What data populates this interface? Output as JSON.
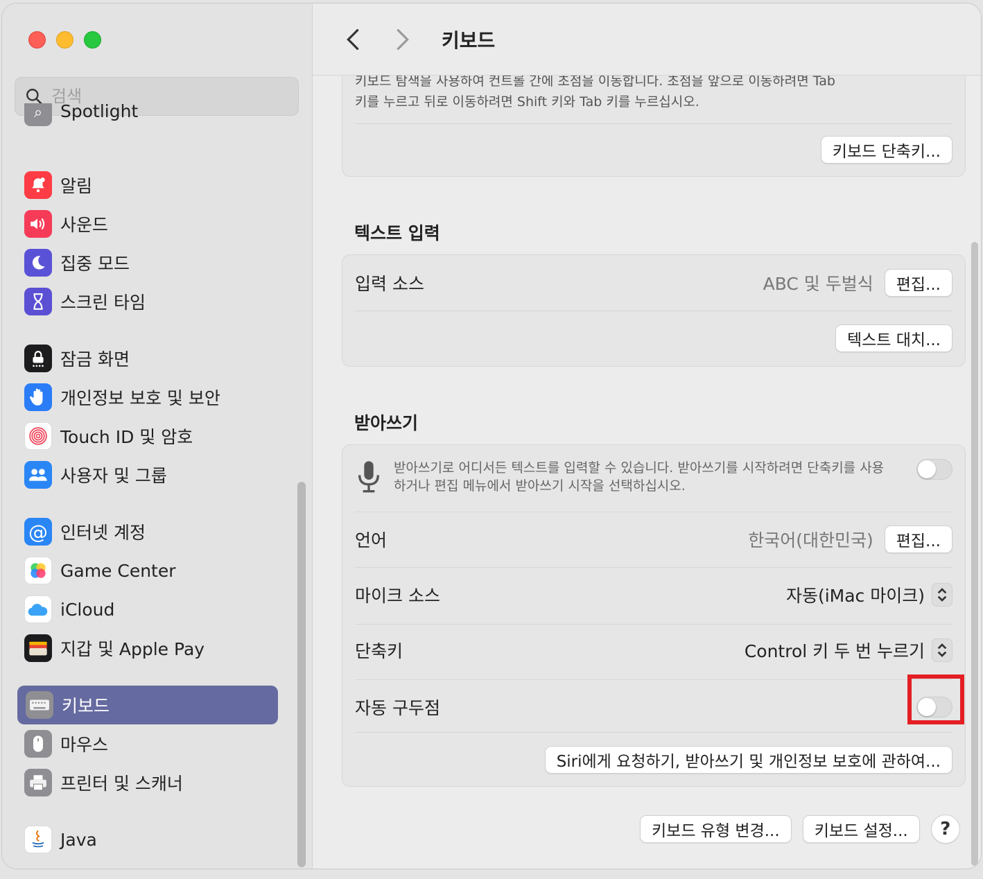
{
  "window": {
    "title": "키보드"
  },
  "sidebar": {
    "search_placeholder": "검색",
    "partial_item": "Spotlight",
    "items": [
      {
        "label": "알림",
        "icon": "bell-icon",
        "color": "#fd3c45"
      },
      {
        "label": "사운드",
        "icon": "speaker-icon",
        "color": "#f53b58"
      },
      {
        "label": "집중 모드",
        "icon": "moon-icon",
        "color": "#5a52d6"
      },
      {
        "label": "스크린 타임",
        "icon": "hourglass-icon",
        "color": "#5b4fd4"
      },
      {
        "label": "잠금 화면",
        "icon": "lock-icon",
        "color": "#1c1c1e"
      },
      {
        "label": "개인정보 보호 및 보안",
        "icon": "hand-icon",
        "color": "#2a7cf7"
      },
      {
        "label": "Touch ID 및 암호",
        "icon": "fingerprint-icon",
        "color": "#ffffff"
      },
      {
        "label": "사용자 및 그룹",
        "icon": "users-icon",
        "color": "#2a86f5"
      },
      {
        "label": "인터넷 계정",
        "icon": "at-icon",
        "color": "#2a86f5"
      },
      {
        "label": "Game Center",
        "icon": "game-center-icon",
        "color": "#ffffff"
      },
      {
        "label": "iCloud",
        "icon": "cloud-icon",
        "color": "#ffffff"
      },
      {
        "label": "지갑 및 Apple Pay",
        "icon": "wallet-icon",
        "color": "#1c1c1e"
      },
      {
        "label": "키보드",
        "icon": "keyboard-icon",
        "color": "#8e8e93",
        "active": true
      },
      {
        "label": "마우스",
        "icon": "mouse-icon",
        "color": "#8e8e93"
      },
      {
        "label": "프린터 및 스캐너",
        "icon": "printer-icon",
        "color": "#8e8e93"
      },
      {
        "label": "Java",
        "icon": "java-icon",
        "color": "#ffffff"
      }
    ]
  },
  "nav_section": {
    "desc_line1": "키보드 탐색을 사용하여 컨트롤 간에 초점을 이동합니다. 초점을 앞으로 이동하려면 Tab",
    "desc_line2": "키를 누르고 뒤로 이동하려면 Shift 키와 Tab 키를 누르십시오.",
    "shortcuts_button": "키보드 단축키..."
  },
  "text_input": {
    "title": "텍스트 입력",
    "input_sources_label": "입력 소스",
    "input_sources_value": "ABC 및 두벌식",
    "input_sources_edit": "편집...",
    "text_replacements_button": "텍스트 대치..."
  },
  "dictation": {
    "title": "받아쓰기",
    "description_line1": "받아쓰기로 어디서든 텍스트를 입력할 수 있습니다. 받아쓰기를 시작하려면 단축키를 사용",
    "description_line2": "하거나 편집 메뉴에서 받아쓰기 시작을 선택하십시오.",
    "enabled": false,
    "language_label": "언어",
    "language_value": "한국어(대한민국)",
    "language_edit": "편집...",
    "mic_label": "마이크 소스",
    "mic_value": "자동(iMac 마이크)",
    "shortcut_label": "단축키",
    "shortcut_value": "Control 키 두 번 누르기",
    "auto_punct_label": "자동 구두점",
    "auto_punct_enabled": false,
    "about_button": "Siri에게 요청하기, 받아쓰기 및 개인정보 보호에 관하여..."
  },
  "footer": {
    "change_type_button": "키보드 유형 변경...",
    "setup_button": "키보드 설정...",
    "help": "?"
  },
  "colors": {
    "highlight": "#e31e24",
    "active_sidebar": "#656aa0"
  }
}
